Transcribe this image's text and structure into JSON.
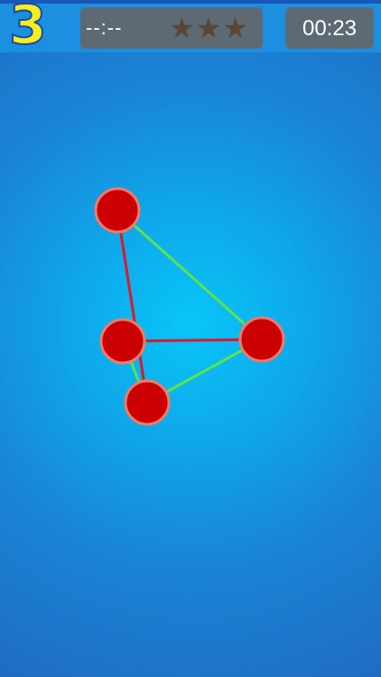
{
  "header": {
    "level": "3",
    "best_time": "--:--",
    "stars": [
      "★",
      "★",
      "★"
    ],
    "timer": "00:23"
  },
  "puzzle": {
    "colors": {
      "node_fill": "#cc0000",
      "node_stroke": "#f07a6a",
      "edge_ok": "#5ee24a",
      "edge_crossing": "#d81b2a"
    },
    "nodes": [
      {
        "id": "n1"
      },
      {
        "id": "n2"
      },
      {
        "id": "n3"
      },
      {
        "id": "n4"
      }
    ],
    "edges": [
      {
        "from": "n1",
        "to": "n3",
        "state": "ok"
      },
      {
        "from": "n3",
        "to": "n4",
        "state": "ok"
      },
      {
        "from": "n4",
        "to": "n2",
        "state": "ok"
      },
      {
        "from": "n1",
        "to": "n4",
        "state": "crossing"
      },
      {
        "from": "n2",
        "to": "n3",
        "state": "crossing"
      }
    ]
  }
}
